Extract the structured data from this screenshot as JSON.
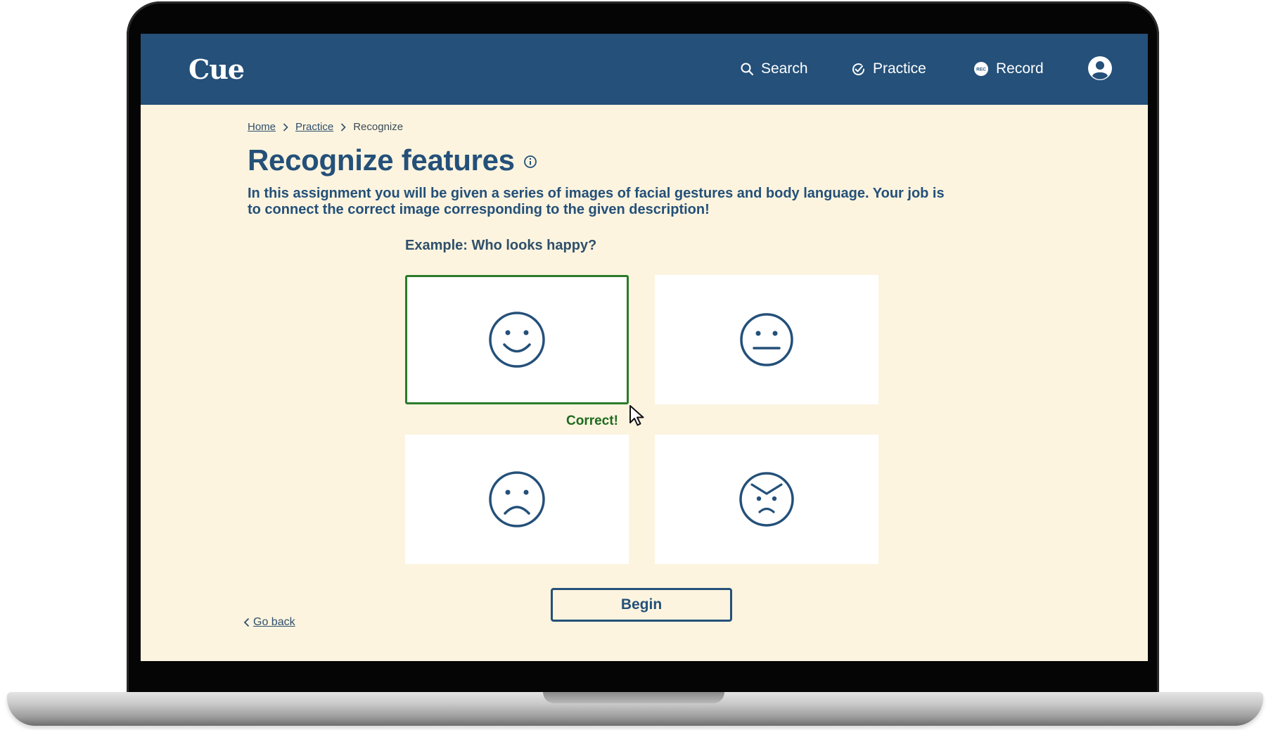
{
  "navbar": {
    "logo": "Cue",
    "search_label": "Search",
    "practice_label": "Practice",
    "record_label": "Record",
    "record_badge": "REC"
  },
  "breadcrumb": {
    "home": "Home",
    "practice": "Practice",
    "current": "Recognize"
  },
  "page": {
    "title": "Recognize features",
    "description": "In this assignment you will be given a series of images of facial gestures and body language. Your job is to connect the correct image corresponding to the given description!",
    "example_label": "Example: Who looks happy?"
  },
  "cards": [
    {
      "icon": "smiley-face-icon",
      "selected": true
    },
    {
      "icon": "neutral-face-icon",
      "selected": false
    },
    {
      "icon": "sad-face-icon",
      "selected": false
    },
    {
      "icon": "angry-face-icon",
      "selected": false
    }
  ],
  "feedback": {
    "text": "Correct!",
    "color": "#1e6b1e"
  },
  "actions": {
    "begin_label": "Begin",
    "go_back_label": "Go back"
  },
  "colors": {
    "brand_navy": "#245079",
    "page_background": "#fcf4df",
    "correct_green": "#2b7a2b"
  }
}
